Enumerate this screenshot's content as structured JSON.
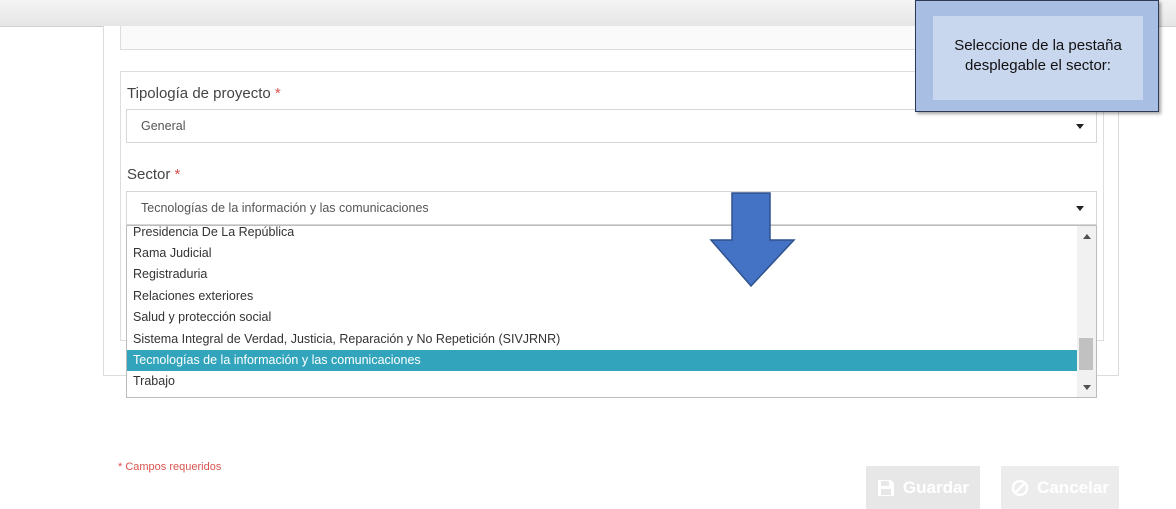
{
  "tooltip": {
    "line1": "Seleccione de la pestaña",
    "line2": "desplegable el sector:"
  },
  "form": {
    "tipologia": {
      "label": "Tipología de proyecto",
      "required_mark": "*",
      "value": "General"
    },
    "sector": {
      "label": "Sector",
      "required_mark": "*",
      "value": "Tecnologías de la información y las comunicaciones"
    }
  },
  "dropdown": {
    "options": [
      "Presidencia De La República",
      "Rama Judicial",
      "Registraduria",
      "Relaciones exteriores",
      "Salud y protección social",
      "Sistema Integral de Verdad, Justicia, Reparación y No Repetición (SIVJRNR)",
      "Tecnologías de la información y las comunicaciones",
      "Trabajo"
    ],
    "selected_index": 6
  },
  "footer": {
    "required_note": "* Campos requeridos",
    "save_label": "Guardar",
    "cancel_label": "Cancelar"
  },
  "colors": {
    "selected_option": "#32a5bd",
    "arrow_fill": "#4472c4",
    "tooltip_bg": "#a8bfe3",
    "required": "#d9534f"
  }
}
